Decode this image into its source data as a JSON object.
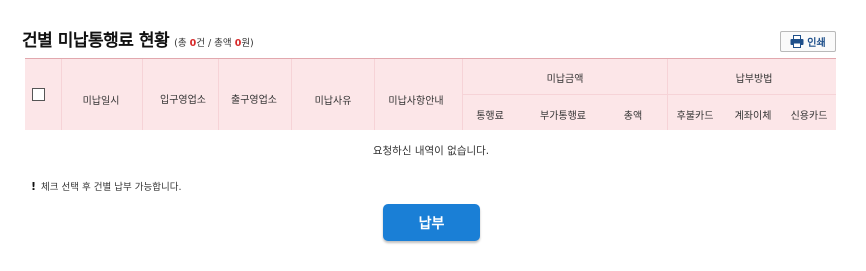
{
  "header": {
    "title": "건별 미납통행료 현황",
    "summary_prefix": "(총 ",
    "count": "0",
    "summary_mid": "건 / 총액 ",
    "amount": "0",
    "summary_suffix": "원)"
  },
  "print_button": {
    "label": "인쇄",
    "icon": "printer-icon"
  },
  "table": {
    "columns": {
      "date": "미납일시",
      "entry": "입구영업소",
      "exit": "출구영업소",
      "reason": "미납사유",
      "guide": "미납사항안내",
      "amount_group": "미납금액",
      "toll": "통행료",
      "extra_toll": "부가통행료",
      "total": "총액",
      "method_group": "납부방법",
      "postpaid_card": "후불카드",
      "transfer": "계좌이체",
      "credit_card": "신용카드"
    },
    "empty_message": "요청하신 내역이 없습니다.",
    "header_bg": "#fce6e8"
  },
  "notice": {
    "mark": "!",
    "text": "체크 선택 후 건별 납부 가능합니다."
  },
  "pay_button": {
    "label": "납부",
    "color": "#1a7fd6"
  }
}
